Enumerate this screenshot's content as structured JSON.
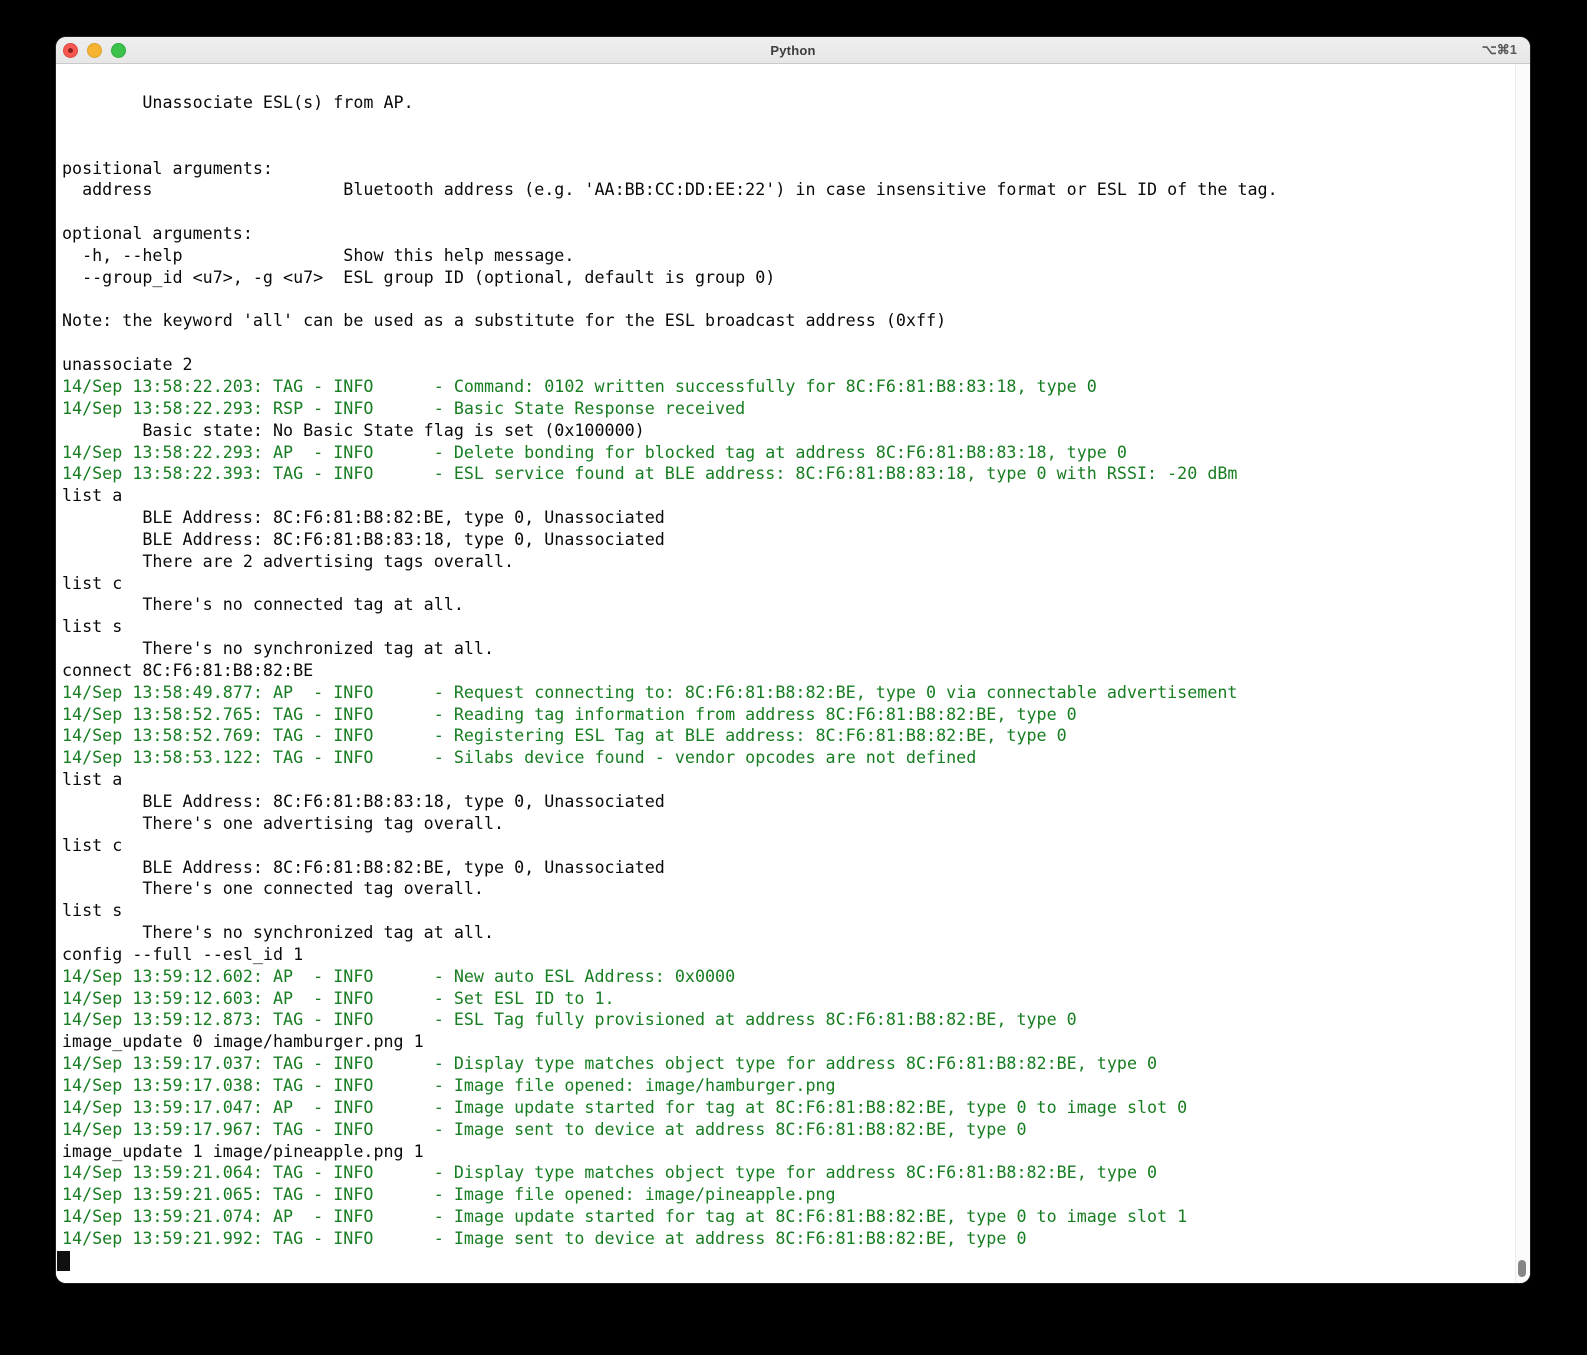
{
  "window": {
    "title": "Python",
    "shortcut": "⌥⌘1"
  },
  "terminal": {
    "colors": {
      "green": "#177d21",
      "black": "#0a0a0a"
    },
    "lines": [
      {
        "c": "k",
        "t": "        Unassociate ESL(s) from AP."
      },
      {
        "c": "k",
        "t": ""
      },
      {
        "c": "k",
        "t": ""
      },
      {
        "c": "k",
        "t": "positional arguments:"
      },
      {
        "c": "k",
        "t": "  address                   Bluetooth address (e.g. 'AA:BB:CC:DD:EE:22') in case insensitive format or ESL ID of the tag."
      },
      {
        "c": "k",
        "t": ""
      },
      {
        "c": "k",
        "t": "optional arguments:"
      },
      {
        "c": "k",
        "t": "  -h, --help                Show this help message."
      },
      {
        "c": "k",
        "t": "  --group_id <u7>, -g <u7>  ESL group ID (optional, default is group 0)"
      },
      {
        "c": "k",
        "t": ""
      },
      {
        "c": "k",
        "t": "Note: the keyword 'all' can be used as a substitute for the ESL broadcast address (0xff)"
      },
      {
        "c": "k",
        "t": ""
      },
      {
        "c": "k",
        "t": "unassociate 2"
      },
      {
        "c": "g",
        "t": "14/Sep 13:58:22.203: TAG - INFO      - Command: 0102 written successfully for 8C:F6:81:B8:83:18, type 0"
      },
      {
        "c": "g",
        "t": "14/Sep 13:58:22.293: RSP - INFO      - Basic State Response received"
      },
      {
        "c": "k",
        "t": "        Basic state: No Basic State flag is set (0x100000)"
      },
      {
        "c": "g",
        "t": "14/Sep 13:58:22.293: AP  - INFO      - Delete bonding for blocked tag at address 8C:F6:81:B8:83:18, type 0"
      },
      {
        "c": "g",
        "t": "14/Sep 13:58:22.393: TAG - INFO      - ESL service found at BLE address: 8C:F6:81:B8:83:18, type 0 with RSSI: -20 dBm"
      },
      {
        "c": "k",
        "t": "list a"
      },
      {
        "c": "k",
        "t": "        BLE Address: 8C:F6:81:B8:82:BE, type 0, Unassociated"
      },
      {
        "c": "k",
        "t": "        BLE Address: 8C:F6:81:B8:83:18, type 0, Unassociated"
      },
      {
        "c": "k",
        "t": "        There are 2 advertising tags overall."
      },
      {
        "c": "k",
        "t": "list c"
      },
      {
        "c": "k",
        "t": "        There's no connected tag at all."
      },
      {
        "c": "k",
        "t": "list s"
      },
      {
        "c": "k",
        "t": "        There's no synchronized tag at all."
      },
      {
        "c": "k",
        "t": "connect 8C:F6:81:B8:82:BE"
      },
      {
        "c": "g",
        "t": "14/Sep 13:58:49.877: AP  - INFO      - Request connecting to: 8C:F6:81:B8:82:BE, type 0 via connectable advertisement"
      },
      {
        "c": "g",
        "t": "14/Sep 13:58:52.765: TAG - INFO      - Reading tag information from address 8C:F6:81:B8:82:BE, type 0"
      },
      {
        "c": "g",
        "t": "14/Sep 13:58:52.769: TAG - INFO      - Registering ESL Tag at BLE address: 8C:F6:81:B8:82:BE, type 0"
      },
      {
        "c": "g",
        "t": "14/Sep 13:58:53.122: TAG - INFO      - Silabs device found - vendor opcodes are not defined"
      },
      {
        "c": "k",
        "t": "list a"
      },
      {
        "c": "k",
        "t": "        BLE Address: 8C:F6:81:B8:83:18, type 0, Unassociated"
      },
      {
        "c": "k",
        "t": "        There's one advertising tag overall."
      },
      {
        "c": "k",
        "t": "list c"
      },
      {
        "c": "k",
        "t": "        BLE Address: 8C:F6:81:B8:82:BE, type 0, Unassociated"
      },
      {
        "c": "k",
        "t": "        There's one connected tag overall."
      },
      {
        "c": "k",
        "t": "list s"
      },
      {
        "c": "k",
        "t": "        There's no synchronized tag at all."
      },
      {
        "c": "k",
        "t": "config --full --esl_id 1"
      },
      {
        "c": "g",
        "t": "14/Sep 13:59:12.602: AP  - INFO      - New auto ESL Address: 0x0000"
      },
      {
        "c": "g",
        "t": "14/Sep 13:59:12.603: AP  - INFO      - Set ESL ID to 1."
      },
      {
        "c": "g",
        "t": "14/Sep 13:59:12.873: TAG - INFO      - ESL Tag fully provisioned at address 8C:F6:81:B8:82:BE, type 0"
      },
      {
        "c": "k",
        "t": "image_update 0 image/hamburger.png 1"
      },
      {
        "c": "g",
        "t": "14/Sep 13:59:17.037: TAG - INFO      - Display type matches object type for address 8C:F6:81:B8:82:BE, type 0"
      },
      {
        "c": "g",
        "t": "14/Sep 13:59:17.038: TAG - INFO      - Image file opened: image/hamburger.png"
      },
      {
        "c": "g",
        "t": "14/Sep 13:59:17.047: AP  - INFO      - Image update started for tag at 8C:F6:81:B8:82:BE, type 0 to image slot 0"
      },
      {
        "c": "g",
        "t": "14/Sep 13:59:17.967: TAG - INFO      - Image sent to device at address 8C:F6:81:B8:82:BE, type 0"
      },
      {
        "c": "k",
        "t": "image_update 1 image/pineapple.png 1"
      },
      {
        "c": "g",
        "t": "14/Sep 13:59:21.064: TAG - INFO      - Display type matches object type for address 8C:F6:81:B8:82:BE, type 0"
      },
      {
        "c": "g",
        "t": "14/Sep 13:59:21.065: TAG - INFO      - Image file opened: image/pineapple.png"
      },
      {
        "c": "g",
        "t": "14/Sep 13:59:21.074: AP  - INFO      - Image update started for tag at 8C:F6:81:B8:82:BE, type 0 to image slot 1"
      },
      {
        "c": "g",
        "t": "14/Sep 13:59:21.992: TAG - INFO      - Image sent to device at address 8C:F6:81:B8:82:BE, type 0"
      }
    ]
  }
}
